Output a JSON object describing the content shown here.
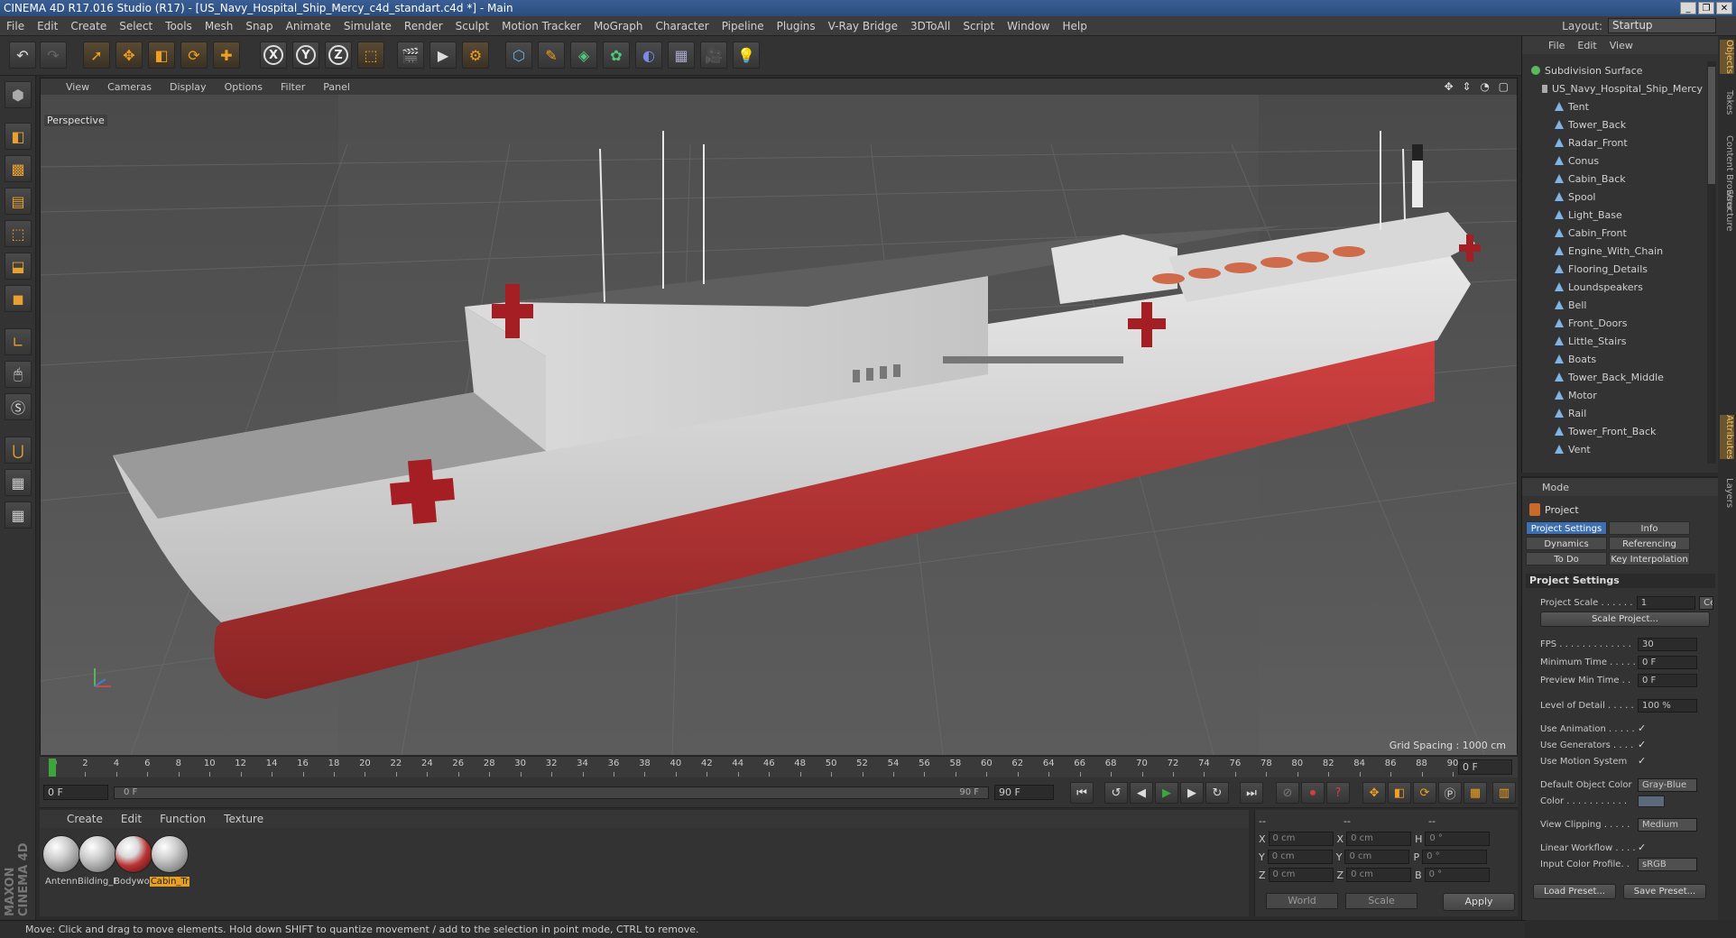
{
  "window": {
    "title": "CINEMA 4D R17.016 Studio (R17) - [US_Navy_Hospital_Ship_Mercy_c4d_standart.c4d *] - Main"
  },
  "menubar": {
    "items": [
      "File",
      "Edit",
      "Create",
      "Select",
      "Tools",
      "Mesh",
      "Snap",
      "Animate",
      "Simulate",
      "Render",
      "Sculpt",
      "Motion Tracker",
      "MoGraph",
      "Character",
      "Pipeline",
      "Plugins",
      "V-Ray Bridge",
      "3DToAll",
      "Script",
      "Window",
      "Help"
    ],
    "layout_label": "Layout:",
    "layout_value": "Startup"
  },
  "toolbar": {
    "axis_labels": [
      "X",
      "Y",
      "Z"
    ]
  },
  "viewport": {
    "menu": [
      "View",
      "Cameras",
      "Display",
      "Options",
      "Filter",
      "Panel"
    ],
    "camera_label": "Perspective",
    "grid_spacing": "Grid Spacing : 1000 cm",
    "nav_icons": "✥ ⇕ ◔ ▢"
  },
  "timeline": {
    "ticks": [
      "0",
      "2",
      "4",
      "6",
      "8",
      "10",
      "12",
      "14",
      "16",
      "18",
      "20",
      "22",
      "24",
      "26",
      "28",
      "30",
      "32",
      "34",
      "36",
      "38",
      "40",
      "42",
      "44",
      "46",
      "48",
      "50",
      "52",
      "54",
      "56",
      "58",
      "60",
      "62",
      "64",
      "66",
      "68",
      "70",
      "72",
      "74",
      "76",
      "78",
      "80",
      "82",
      "84",
      "86",
      "88",
      "90"
    ],
    "current_frame": "0 F"
  },
  "transport": {
    "start_field": "0 F",
    "scrub_start": "0 F",
    "scrub_end": "90 F",
    "end_field": "90 F"
  },
  "materials": {
    "menu": [
      "Create",
      "Edit",
      "Function",
      "Texture"
    ],
    "items": [
      {
        "name": "Antenn",
        "style": "white"
      },
      {
        "name": "Bilding_F",
        "style": "white"
      },
      {
        "name": "Bodywor",
        "style": "red"
      },
      {
        "name": "Cabin_Tr",
        "style": "white",
        "active": true
      }
    ]
  },
  "coordinates": {
    "header": [
      "--",
      "--",
      "--"
    ],
    "rows": [
      {
        "a": "X",
        "av": "0 cm",
        "b": "X",
        "bv": "0 cm",
        "c": "H",
        "cv": "0 °"
      },
      {
        "a": "Y",
        "av": "0 cm",
        "b": "Y",
        "bv": "0 cm",
        "c": "P",
        "cv": "0 °"
      },
      {
        "a": "Z",
        "av": "0 cm",
        "b": "Z",
        "bv": "0 cm",
        "c": "B",
        "cv": "0 °"
      }
    ],
    "world": "World",
    "scale": "Scale",
    "apply": "Apply"
  },
  "status": {
    "text": "Move: Click and drag to move elements. Hold down SHIFT to quantize movement / add to the selection in point mode, CTRL to remove."
  },
  "brand": "MAXON CINEMA 4D",
  "object_manager": {
    "menu": [
      "File",
      "Edit",
      "View"
    ],
    "root": "Subdivision Surface",
    "group": "US_Navy_Hospital_Ship_Mercy",
    "objects": [
      "Tent",
      "Tower_Back",
      "Radar_Front",
      "Conus",
      "Cabin_Back",
      "Spool",
      "Light_Base",
      "Cabin_Front",
      "Engine_With_Chain",
      "Flooring_Details",
      "Loundspeakers",
      "Bell",
      "Front_Doors",
      "Little_Stairs",
      "Boats",
      "Tower_Back_Middle",
      "Motor",
      "Rail",
      "Tower_Front_Back",
      "Vent"
    ]
  },
  "side_tabs": [
    "Objects",
    "Takes",
    "Content Browser",
    "Structure",
    "Attributes",
    "Layers"
  ],
  "attributes": {
    "mode": "Mode",
    "title": "Project",
    "tabs": [
      "Project Settings",
      "Info",
      "Dynamics",
      "Referencing",
      "To Do",
      "Key Interpolation"
    ],
    "section": "Project Settings",
    "project_scale_label": "Project Scale . . . . . .",
    "project_scale_value": "1",
    "project_scale_unit": "Ce",
    "scale_project_btn": "Scale Project...",
    "fps_label": "FPS . . . . . . . . . . . . .",
    "fps_value": "30",
    "min_time_label": "Minimum Time . . . . .",
    "min_time_value": "0 F",
    "preview_min_label": "Preview Min Time . .",
    "preview_min_value": "0 F",
    "lod_label": "Level of Detail . . . . .",
    "lod_value": "100 %",
    "use_anim_label": "Use Animation . . . . .",
    "use_gen_label": "Use Generators . . . .",
    "use_motion_label": "Use Motion System",
    "check": "✓",
    "default_color_label": "Default Object Color",
    "default_color_value": "Gray-Blue",
    "color_label": "Color . . . . . . . . . . .",
    "view_clipping_label": "View Clipping . . . . .",
    "view_clipping_value": "Medium",
    "linear_label": "Linear Workflow . . . .",
    "input_color_label": "Input Color Profile. .",
    "input_color_value": "sRGB",
    "load_preset": "Load Preset...",
    "save_preset": "Save Preset..."
  }
}
